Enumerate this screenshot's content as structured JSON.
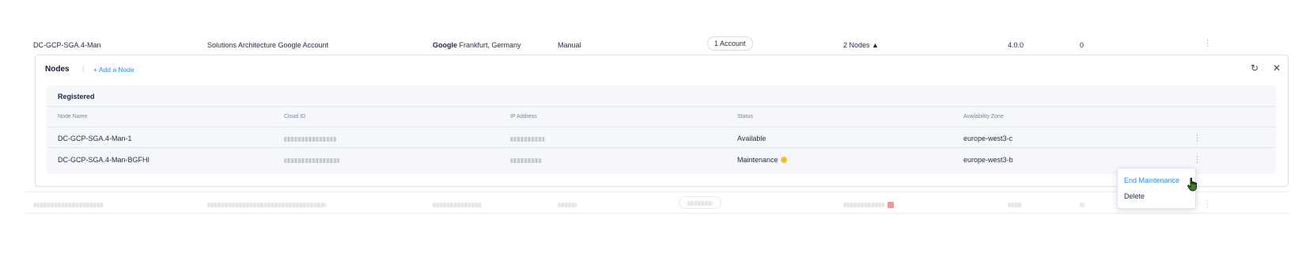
{
  "cluster_row": {
    "name": "DC-GCP-SGA.4-Man",
    "account": "Solutions Architecture Google Account",
    "provider": "Google",
    "region": "Frankfurt, Germany",
    "type": "Manual",
    "accounts_badge": "1 Account",
    "nodes_toggle": "2 Nodes",
    "nodes_toggle_icon": "caret-up-icon",
    "version": "4.0.0",
    "count": "0"
  },
  "nodes_panel": {
    "title": "Nodes",
    "separator": "|",
    "add_node": "+ Add a Node",
    "section": "Registered",
    "columns": [
      "Node Name",
      "Cloud ID",
      "IP Address",
      "Status",
      "Availability Zone"
    ],
    "rows": [
      {
        "name": "DC-GCP-SGA.4-Man-1",
        "status": "Available",
        "zone": "europe-west3-c"
      },
      {
        "name": "DC-GCP-SGA.4-Man-BGFHI",
        "status": "Maintenance",
        "zone": "europe-west3-b"
      }
    ]
  },
  "context_menu": {
    "items": [
      "End Maintenance",
      "Delete"
    ]
  },
  "colors": {
    "accent": "#2f8bef",
    "warning": "#f5b82e",
    "danger": "#e8434a"
  }
}
